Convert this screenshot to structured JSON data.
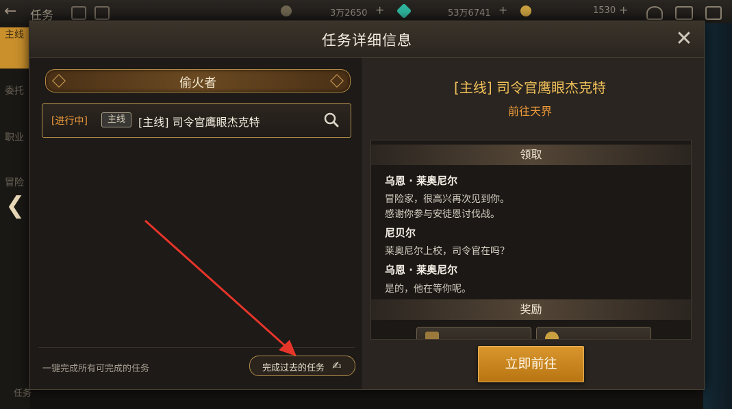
{
  "background": {
    "top_title": "任务",
    "resources": [
      {
        "value": "3万2650",
        "icon": "moon-icon",
        "color": "#9c8f6a"
      },
      {
        "value": "53万6741",
        "icon": "crystal-icon",
        "color": "#2fb6a0"
      },
      {
        "value": "1530",
        "icon": "gold-coin-icon",
        "color": "#c8a040"
      }
    ],
    "side_tabs": [
      "主线",
      "委托",
      "职业",
      "冒险"
    ],
    "bottom_label": "任务"
  },
  "modal": {
    "title": "任务详细信息",
    "close_icon": "close-icon"
  },
  "left": {
    "chapter": "偷火者",
    "quest": {
      "status": "[进行中]",
      "badge": "主线",
      "name": "[主线] 司令官鹰眼杰克特"
    },
    "auto_complete_label": "一键完成所有可完成的任务",
    "past_button": "完成过去的任务"
  },
  "right": {
    "quest_title": "[主线] 司令官鹰眼杰克特",
    "quest_subtitle": "前往天界",
    "receive_header": "领取",
    "dialog": [
      {
        "speaker": "乌恩 · 莱奥尼尔",
        "lines": [
          "冒险家，很高兴再次见到你。",
          "感谢你参与安徒恩讨伐战。"
        ]
      },
      {
        "speaker": "尼贝尔",
        "lines": [
          "莱奥尼尔上校，司令官在吗？"
        ]
      },
      {
        "speaker": "乌恩 · 莱奥尼尔",
        "lines": [
          "是的，他在等你呢。"
        ]
      }
    ],
    "reward_header": "奖励",
    "go_button": "立即前往"
  },
  "colors": {
    "accent_gold": "#f1c15a",
    "status_orange": "#ee9a3a",
    "button_orange": "#c8841c"
  }
}
